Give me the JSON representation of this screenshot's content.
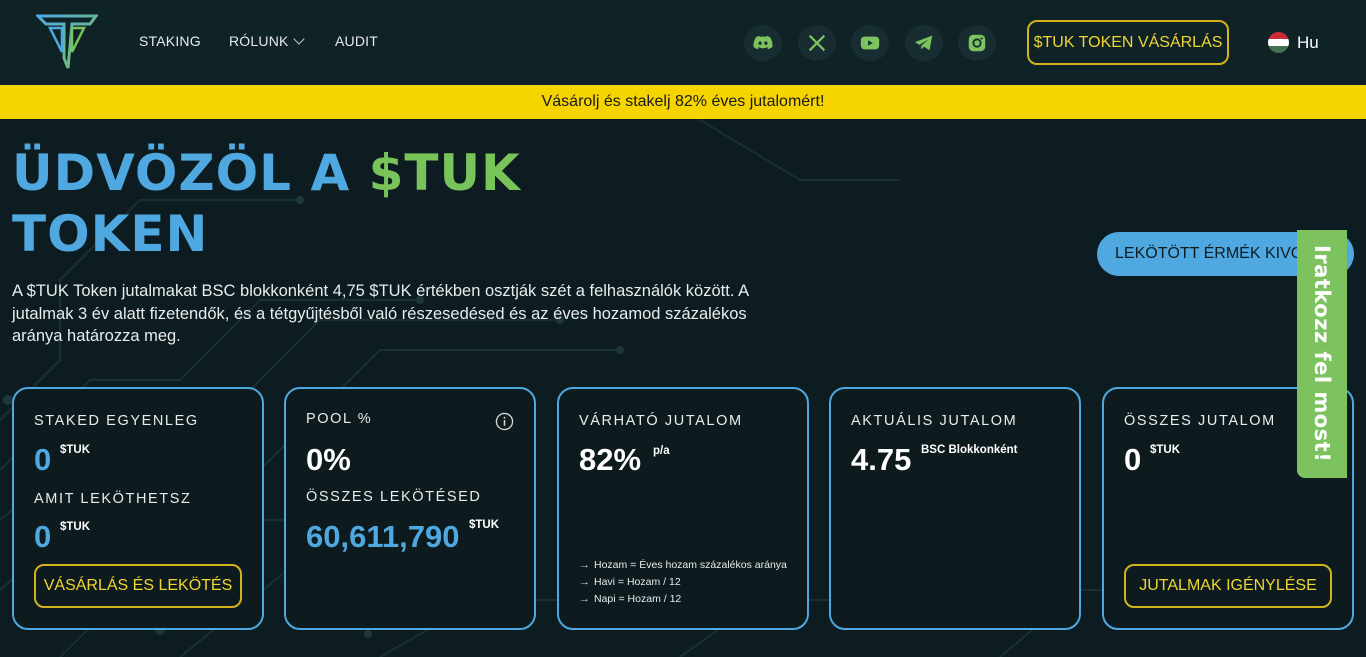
{
  "nav": {
    "links": [
      "STAKING",
      "RÓLUNK",
      "AUDIT"
    ],
    "socials": [
      "discord-icon",
      "x-icon",
      "youtube-icon",
      "telegram-icon",
      "instagram-icon"
    ],
    "buy_label": "$TUK TOKEN VÁSÁRLÁS",
    "lang_label": "Hu"
  },
  "banner": {
    "text": "Vásárolj és stakelj 82% éves jutalomért!"
  },
  "hero": {
    "title_part1": "ÜDVÖZÖL A ",
    "title_part2": "$TUK",
    "title_part3": "TOKEN",
    "description": "A $TUK Token jutalmakat BSC blokkonként 4,75 $TUK értékben osztják szét a felhasználók között. A jutalmak 3 év alatt fizetendők, és a tétgyűjtésből való részesedésed és az éves hozamod százalékos aránya határozza meg.",
    "withdraw_label": "LEKÖTÖTT ÉRMÉK KIVONÁSA",
    "signup_label": "Iratkozz fel most!"
  },
  "cards": {
    "staked": {
      "label": "STAKED EGYENLEG",
      "value": "0",
      "unit": "$TUK",
      "label2": "AMIT LEKÖTHETSZ",
      "value2": "0",
      "unit2": "$TUK",
      "button": "VÁSÁRLÁS ÉS LEKÖTÉS"
    },
    "pool": {
      "label": "POOL %",
      "value": "0%",
      "label2": "ÖSSZES LEKÖTÉSED",
      "value2": "60,611,790",
      "unit2": "$TUK"
    },
    "expected": {
      "label": "VÁRHATÓ JUTALOM",
      "value": "82%",
      "unit": "p/a",
      "formulas": [
        "Hozam = Éves hozam százalékos aránya",
        "Havi = Hozam / 12",
        "Napi = Hozam / 12"
      ]
    },
    "current": {
      "label": "AKTUÁLIS JUTALOM",
      "value": "4.75",
      "unit": "BSC Blokkonként"
    },
    "total": {
      "label": "ÖSSZES JUTALOM",
      "value": "0",
      "unit": "$TUK",
      "button": "JUTALMAK IGÉNYLÉSE"
    }
  },
  "colors": {
    "accent_blue": "#4fa8e0",
    "accent_green": "#78c35a",
    "gold": "#d2b31b",
    "banner": "#f5d400"
  }
}
